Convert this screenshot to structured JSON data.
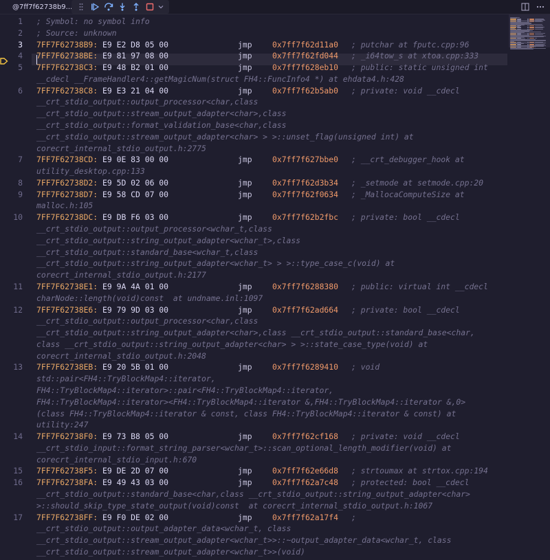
{
  "tab": {
    "title": "@7ff7f62738b9..."
  },
  "debug_toolbar": {
    "icons": [
      "drag-grip-icon",
      "continue-icon",
      "step-over-icon",
      "step-into-icon",
      "step-out-icon",
      "stop-icon",
      "chevron-down-icon"
    ]
  },
  "editor_actions": {
    "icons": [
      "split-editor-icon",
      "more-actions-icon"
    ]
  },
  "colors": {
    "address": "#e9a866",
    "target": "#f09a6a",
    "comment": "#75718f",
    "background": "#1f1e2e"
  },
  "current_line": 3,
  "lines": [
    {
      "n": "1",
      "comment": "; Symbol: no symbol info"
    },
    {
      "n": "2",
      "comment": "; Source: unknown"
    },
    {
      "n": "3",
      "addr": "7FF7F62738B9:",
      "bytes": "E9 E2 D8 05 00",
      "mnemonic": "jmp",
      "target": "0x7ff7f62d11a0",
      "comment": "; putchar at fputc.cpp:96"
    },
    {
      "n": "4",
      "addr": "7FF7F62738BE:",
      "bytes": "E9 81 97 08 00",
      "mnemonic": "jmp",
      "target": "0x7ff7f62fd044",
      "comment": "; _i64tow_s at xtoa.cpp:333"
    },
    {
      "n": "5",
      "addr": "7FF7F62738C3:",
      "bytes": "E9 48 B2 01 00",
      "mnemonic": "jmp",
      "target": "0x7ff7f628eb10",
      "comment": "; public: static unsigned int"
    },
    {
      "n": "",
      "comment": "__cdecl __FrameHandler4::getMagicNum(struct FH4::FuncInfo4 *) at ehdata4.h:428"
    },
    {
      "n": "6",
      "addr": "7FF7F62738C8:",
      "bytes": "E9 E3 21 04 00",
      "mnemonic": "jmp",
      "target": "0x7ff7f62b5ab0",
      "comment": "; private: void __cdecl"
    },
    {
      "n": "",
      "comment": "__crt_stdio_output::output_processor<char,class"
    },
    {
      "n": "",
      "comment": "__crt_stdio_output::stream_output_adapter<char>,class"
    },
    {
      "n": "",
      "comment": "__crt_stdio_output::format_validation_base<char,class"
    },
    {
      "n": "",
      "comment": "__crt_stdio_output::stream_output_adapter<char> > >::unset_flag(unsigned int) at"
    },
    {
      "n": "",
      "comment": "corecrt_internal_stdio_output.h:2775"
    },
    {
      "n": "7",
      "addr": "7FF7F62738CD:",
      "bytes": "E9 0E 83 00 00",
      "mnemonic": "jmp",
      "target": "0x7ff7f627bbe0",
      "comment": "; __crt_debugger_hook at"
    },
    {
      "n": "",
      "comment": "utility_desktop.cpp:133"
    },
    {
      "n": "8",
      "addr": "7FF7F62738D2:",
      "bytes": "E9 5D 02 06 00",
      "mnemonic": "jmp",
      "target": "0x7ff7f62d3b34",
      "comment": "; _setmode at setmode.cpp:20"
    },
    {
      "n": "9",
      "addr": "7FF7F62738D7:",
      "bytes": "E9 58 CD 07 00",
      "mnemonic": "jmp",
      "target": "0x7ff7f62f0634",
      "comment": "; _MallocaComputeSize at"
    },
    {
      "n": "",
      "comment": "malloc.h:105"
    },
    {
      "n": "10",
      "addr": "7FF7F62738DC:",
      "bytes": "E9 DB F6 03 00",
      "mnemonic": "jmp",
      "target": "0x7ff7f62b2fbc",
      "comment": "; private: bool __cdecl"
    },
    {
      "n": "",
      "comment": "__crt_stdio_output::output_processor<wchar_t,class"
    },
    {
      "n": "",
      "comment": "__crt_stdio_output::string_output_adapter<wchar_t>,class"
    },
    {
      "n": "",
      "comment": "__crt_stdio_output::standard_base<wchar_t,class"
    },
    {
      "n": "",
      "comment": "__crt_stdio_output::string_output_adapter<wchar_t> > >::type_case_c(void) at"
    },
    {
      "n": "",
      "comment": "corecrt_internal_stdio_output.h:2177"
    },
    {
      "n": "11",
      "addr": "7FF7F62738E1:",
      "bytes": "E9 9A 4A 01 00",
      "mnemonic": "jmp",
      "target": "0x7ff7f6288380",
      "comment": "; public: virtual int __cdecl"
    },
    {
      "n": "",
      "comment": "charNode::length(void)const  at undname.inl:1097"
    },
    {
      "n": "12",
      "addr": "7FF7F62738E6:",
      "bytes": "E9 79 9D 03 00",
      "mnemonic": "jmp",
      "target": "0x7ff7f62ad664",
      "comment": "; private: bool __cdecl"
    },
    {
      "n": "",
      "comment": "__crt_stdio_output::output_processor<char,class"
    },
    {
      "n": "",
      "comment": "__crt_stdio_output::string_output_adapter<char>,class __crt_stdio_output::standard_base<char,"
    },
    {
      "n": "",
      "comment": "class __crt_stdio_output::string_output_adapter<char> > >::state_case_type(void) at"
    },
    {
      "n": "",
      "comment": "corecrt_internal_stdio_output.h:2048"
    },
    {
      "n": "13",
      "addr": "7FF7F62738EB:",
      "bytes": "E9 20 5B 01 00",
      "mnemonic": "jmp",
      "target": "0x7ff7f6289410",
      "comment": "; void"
    },
    {
      "n": "",
      "comment": "std::pair<FH4::TryBlockMap4::iterator,"
    },
    {
      "n": "",
      "comment": "FH4::TryBlockMap4::iterator>::pair<FH4::TryBlockMap4::iterator,"
    },
    {
      "n": "",
      "comment": "FH4::TryBlockMap4::iterator><FH4::TryBlockMap4::iterator &,FH4::TryBlockMap4::iterator &,0>"
    },
    {
      "n": "",
      "comment": "(class FH4::TryBlockMap4::iterator & const, class FH4::TryBlockMap4::iterator & const) at"
    },
    {
      "n": "",
      "comment": "utility:247"
    },
    {
      "n": "14",
      "addr": "7FF7F62738F0:",
      "bytes": "E9 73 B8 05 00",
      "mnemonic": "jmp",
      "target": "0x7ff7f62cf168",
      "comment": "; private: void __cdecl"
    },
    {
      "n": "",
      "comment": "__crt_stdio_input::format_string_parser<wchar_t>::scan_optional_length_modifier(void) at"
    },
    {
      "n": "",
      "comment": "corecrt_internal_stdio_input.h:670"
    },
    {
      "n": "15",
      "addr": "7FF7F62738F5:",
      "bytes": "E9 DE 2D 07 00",
      "mnemonic": "jmp",
      "target": "0x7ff7f62e66d8",
      "comment": "; strtoumax at strtox.cpp:194"
    },
    {
      "n": "16",
      "addr": "7FF7F62738FA:",
      "bytes": "E9 49 43 03 00",
      "mnemonic": "jmp",
      "target": "0x7ff7f62a7c48",
      "comment": "; protected: bool __cdecl"
    },
    {
      "n": "",
      "comment": "__crt_stdio_output::standard_base<char,class __crt_stdio_output::string_output_adapter<char>"
    },
    {
      "n": "",
      "comment": ">::should_skip_type_state_output(void)const  at corecrt_internal_stdio_output.h:1067"
    },
    {
      "n": "17",
      "addr": "7FF7F62738FF:",
      "bytes": "E9 F0 DE 02 00",
      "mnemonic": "jmp",
      "target": "0x7ff7f62a17f4",
      "comment": ";"
    },
    {
      "n": "",
      "comment": "__crt_stdio_output::output_adapter_data<wchar_t, class"
    },
    {
      "n": "",
      "comment": "__crt_stdio_output::stream_output_adapter<wchar_t>>::~output_adapter_data<wchar_t, class"
    },
    {
      "n": "",
      "comment": "__crt_stdio_output::stream_output_adapter<wchar_t>>(void)"
    }
  ]
}
